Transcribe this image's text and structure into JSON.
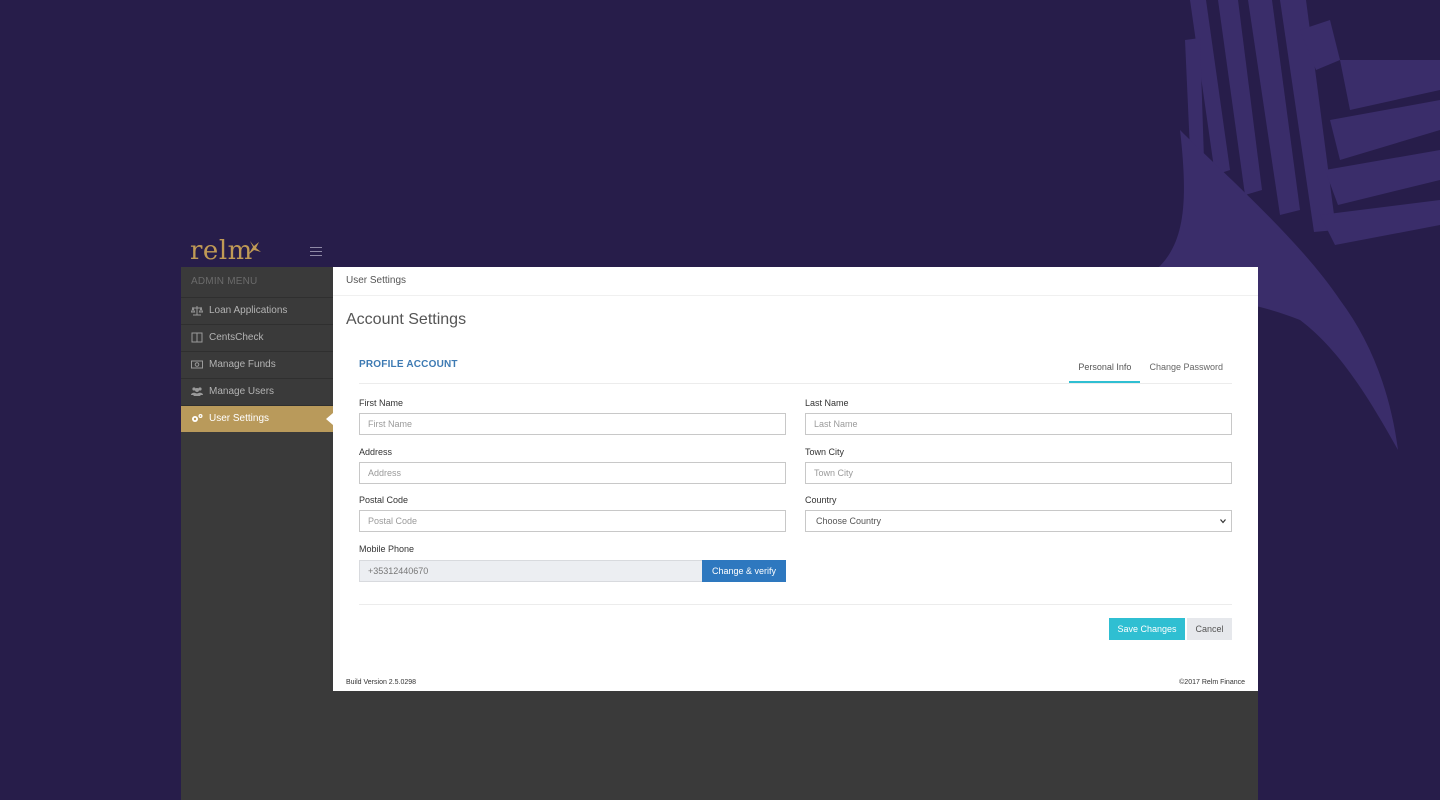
{
  "colors": {
    "background": "#271d4a",
    "bird": "#3a2d6a",
    "sidebar": "#3a3a3a",
    "active_item": "#b99a5b",
    "brand_gold": "#c09a55",
    "primary_blue": "#2e78bf",
    "accent_teal": "#2fbfd2"
  },
  "brand": {
    "logo_text": "relm"
  },
  "sidebar": {
    "heading": "ADMIN MENU",
    "items": [
      {
        "label": "Loan Applications",
        "icon": "scale-icon"
      },
      {
        "label": "CentsCheck",
        "icon": "book-icon"
      },
      {
        "label": "Manage Funds",
        "icon": "money-icon"
      },
      {
        "label": "Manage Users",
        "icon": "users-icon"
      },
      {
        "label": "User Settings",
        "icon": "cogs-icon",
        "active": true
      }
    ]
  },
  "breadcrumb": "User Settings",
  "page_title": "Account Settings",
  "panel": {
    "title": "PROFILE ACCOUNT",
    "tabs": [
      {
        "label": "Personal Info",
        "active": true
      },
      {
        "label": "Change Password",
        "active": false
      }
    ]
  },
  "form": {
    "first_name": {
      "label": "First Name",
      "placeholder": "First Name",
      "value": ""
    },
    "last_name": {
      "label": "Last Name",
      "placeholder": "Last Name",
      "value": ""
    },
    "address": {
      "label": "Address",
      "placeholder": "Address",
      "value": ""
    },
    "town_city": {
      "label": "Town City",
      "placeholder": "Town City",
      "value": ""
    },
    "postal_code": {
      "label": "Postal Code",
      "placeholder": "Postal Code",
      "value": ""
    },
    "country": {
      "label": "Country",
      "selected": "Choose Country"
    },
    "mobile_phone": {
      "label": "Mobile Phone",
      "value": "+35312440670",
      "verify_label": "Change & verify"
    }
  },
  "actions": {
    "save_label": "Save Changes",
    "cancel_label": "Cancel"
  },
  "footer": {
    "build": "Build Version 2.5.0298",
    "copyright": "©2017 Relm Finance"
  }
}
